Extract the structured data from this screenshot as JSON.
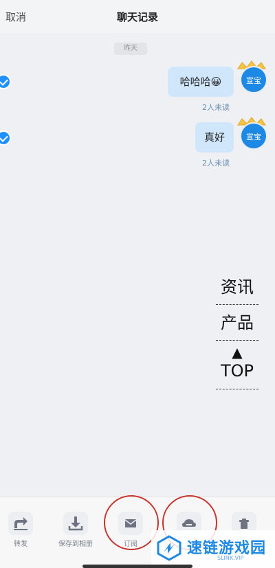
{
  "header": {
    "cancel_label": "取消",
    "title": "聊天记录"
  },
  "timestamp_chip": "昨天",
  "messages": [
    {
      "text": "哈哈哈😀",
      "read_status": "2人未读",
      "avatar_label": "宣宝"
    },
    {
      "text": "真好",
      "read_status": "2人未读",
      "avatar_label": "宣宝"
    }
  ],
  "side_menu": {
    "item1": "资讯",
    "item2": "产品",
    "top_arrow": "▲",
    "top_label": "TOP"
  },
  "bottom_actions": [
    {
      "label": "转发",
      "icon": "share-icon"
    },
    {
      "label": "保存到相册",
      "icon": "download-icon"
    },
    {
      "label": "订阅",
      "icon": "mail-icon"
    },
    {
      "label": "",
      "icon": "cloud-icon"
    },
    {
      "label": "",
      "icon": "trash-icon"
    }
  ],
  "watermark": {
    "title": "速链游戏园",
    "url": "SLINK.VIP"
  },
  "colors": {
    "accent": "#1e88e5",
    "bubble": "#cfe6fb",
    "circle_mark": "#c8322d"
  }
}
